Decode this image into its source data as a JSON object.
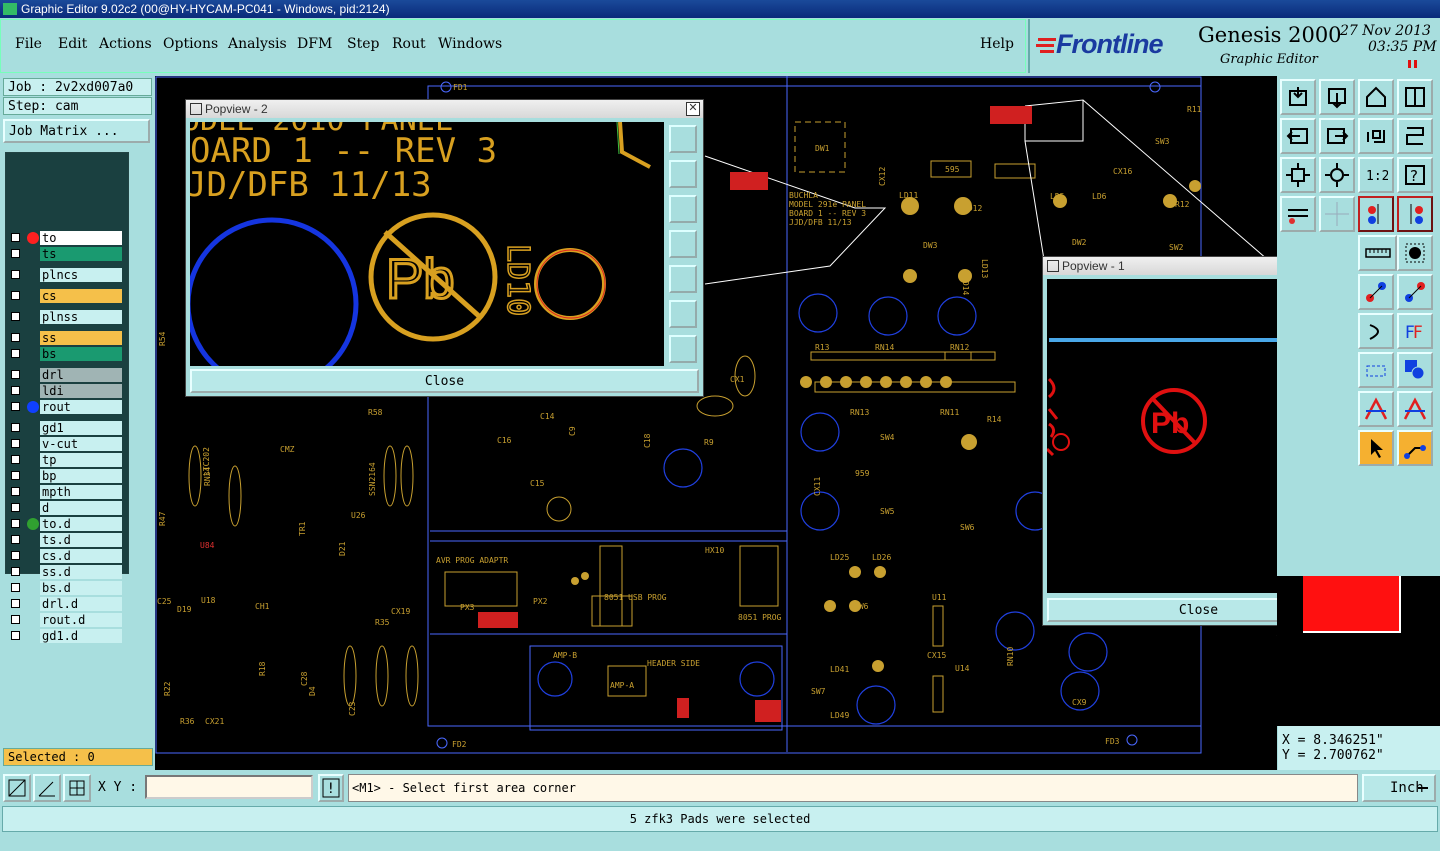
{
  "window_title": "Graphic Editor 9.02c2 (00@HY-HYCAM-PC041 - Windows, pid:2124)",
  "menu": [
    "File",
    "Edit",
    "Actions",
    "Options",
    "Analysis",
    "DFM",
    "Step",
    "Rout",
    "Windows"
  ],
  "help_label": "Help",
  "brand": {
    "name": "Frontline",
    "product": "Genesis 2000",
    "subtitle": "Graphic Editor",
    "date": "27 Nov 2013",
    "time": "03:35 PM"
  },
  "job": {
    "label": "Job : 2v2xd007a0",
    "step": "Step: cam",
    "matrix_button": "Job Matrix ..."
  },
  "layers": [
    {
      "name": "to",
      "color": "#ffffff",
      "dot": "#ff2020"
    },
    {
      "name": "ts",
      "color": "#1a9a70",
      "dot": ""
    },
    {
      "name": "plncs",
      "color": "#c8f0f0",
      "dot": ""
    },
    {
      "name": "cs",
      "color": "#f5c04a",
      "dot": ""
    },
    {
      "name": "plnss",
      "color": "#c8f0f0",
      "dot": ""
    },
    {
      "name": "ss",
      "color": "#f5c04a",
      "dot": ""
    },
    {
      "name": "bs",
      "color": "#1a9a70",
      "dot": ""
    },
    {
      "name": "drl",
      "color": "#a0b4b4",
      "dot": ""
    },
    {
      "name": "ldi",
      "color": "#a0b4b4",
      "dot": ""
    },
    {
      "name": "rout",
      "color": "#c8f0f0",
      "dot": "#1040ff"
    },
    {
      "name": "gd1",
      "color": "#c8f0f0",
      "dot": ""
    },
    {
      "name": "v-cut",
      "color": "#c8f0f0",
      "dot": ""
    },
    {
      "name": "tp",
      "color": "#c8f0f0",
      "dot": ""
    },
    {
      "name": "bp",
      "color": "#c8f0f0",
      "dot": ""
    },
    {
      "name": "mpth",
      "color": "#c8f0f0",
      "dot": ""
    },
    {
      "name": "d",
      "color": "#c8f0f0",
      "dot": ""
    },
    {
      "name": "to.d",
      "color": "#c8f0f0",
      "dot": "#30a030"
    },
    {
      "name": "ts.d",
      "color": "#c8f0f0",
      "dot": ""
    },
    {
      "name": "cs.d",
      "color": "#c8f0f0",
      "dot": ""
    },
    {
      "name": "ss.d",
      "color": "#c8f0f0",
      "dot": ""
    },
    {
      "name": "bs.d",
      "color": "#c8f0f0",
      "dot": ""
    },
    {
      "name": "drl.d",
      "color": "#c8f0f0",
      "dot": ""
    },
    {
      "name": "rout.d",
      "color": "#c8f0f0",
      "dot": ""
    },
    {
      "name": "gd1.d",
      "color": "#c8f0f0",
      "dot": ""
    }
  ],
  "selected": "Selected : 0",
  "popview2": {
    "title": "Popview - 2",
    "close": "Close",
    "text_line1": "OARD 1  --  REV 3",
    "text_line2": "JD/DFB    11/13",
    "text_top": "ODEL 2010 PANEL",
    "pb_label": "Pb",
    "ld_label": "LD10"
  },
  "popview1": {
    "title": "Popview - 1",
    "close": "Close",
    "pb_label": "Pb"
  },
  "coordinates": {
    "x": "X = 8.346251\"",
    "y": "Y = 2.700762\""
  },
  "xy_label": "X Y :",
  "xy_input": "",
  "prompt": "<M1> - Select first area corner",
  "units": "Inch",
  "message": "5 zfk3 Pads were selected",
  "canvas_labels": {
    "fd1": "FD1",
    "fd2": "FD2",
    "fd3": "FD3",
    "r11": "R11",
    "dw1": "DW1",
    "cx12": "CX12",
    "r595": "595",
    "buchla": "BUCHLA",
    "model": "MODEL 291e PANEL",
    "board": "BOARD 1 -- REV 3",
    "jjd": "JJD/DFB 11/13",
    "ld11": "LD11",
    "ld12": "LD12",
    "dw3": "DW3",
    "ld13": "LD13",
    "ld14": "LD14",
    "ld5": "LD5",
    "ld6": "LD6",
    "dw2": "DW2",
    "sw2": "SW2",
    "r12": "R12",
    "cx16": "CX16",
    "sw3": "SW3",
    "rn14": "RN14",
    "rn12": "RN12",
    "r13": "R13",
    "rn13": "RN13",
    "rn11": "RN11",
    "r14": "R14",
    "sw4": "SW4",
    "sw5": "SW5",
    "sw6": "SW6",
    "cx11": "CX11",
    "r959": "959",
    "ld25": "LD25",
    "ld26": "LD26",
    "dw6": "DW6",
    "u11": "U11",
    "cx15": "CX15",
    "u14": "U14",
    "sw7": "SW7",
    "ld41": "LD41",
    "ld49": "LD49",
    "rn10": "RN10",
    "cx9": "CX9",
    "avr": "AVR PROG ADAPTR",
    "px3": "PX3",
    "px2": "PX2",
    "usb": "8051 USB PROG",
    "prog": "8051 PROG",
    "hx10": "HX10",
    "ampb": "AMP-B",
    "ampa": "AMP-A",
    "header": "HEADER SIDE",
    "c14": "C14",
    "c15": "C15",
    "c16": "C16",
    "c9": "C9",
    "c18": "C18",
    "r9": "R9",
    "r58": "R58",
    "u26": "U26",
    "ssn": "SSN2164",
    "u84": "U84",
    "rn34": "RN34",
    "ltc": "LTC202",
    "u18": "U18",
    "d19": "D19",
    "r22": "R22",
    "r36": "R36",
    "cx21": "CX21",
    "c25": "C25",
    "ch1": "CH1",
    "cx19": "CX19",
    "r35": "R35",
    "tr1": "TR1",
    "d21": "D21",
    "cmz": "CMZ",
    "r18": "R18",
    "c28": "C28",
    "d4": "D4",
    "c23": "C23",
    "r47": "R47",
    "r54": "R54",
    "cx1": "CX1"
  }
}
